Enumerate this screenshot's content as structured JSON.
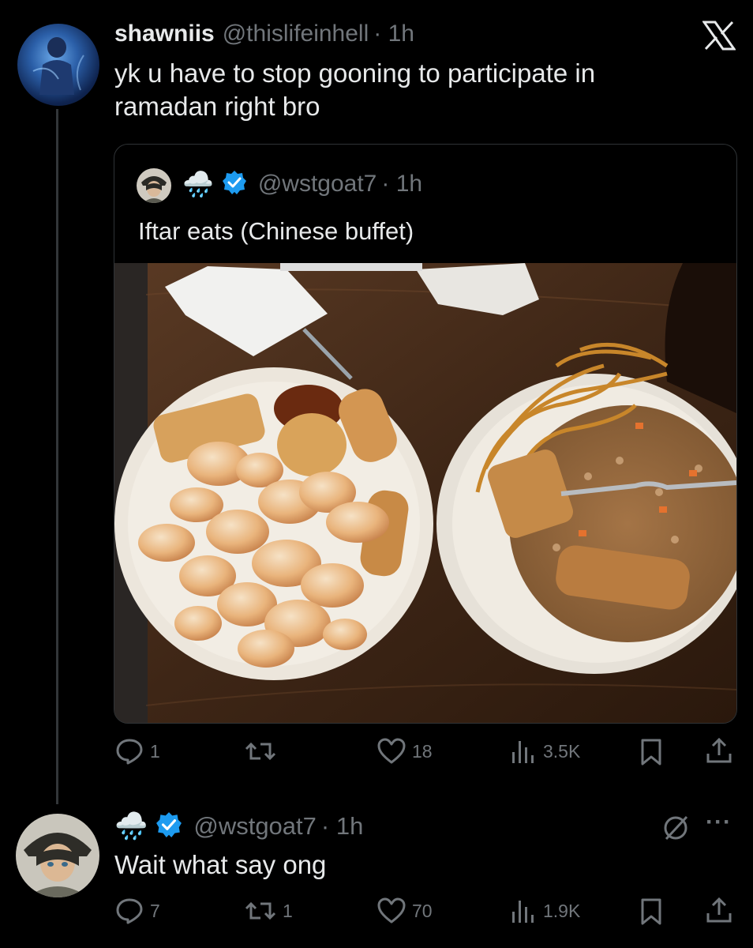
{
  "post": {
    "author_name": "shawniis",
    "author_handle": "@thislifeinhell",
    "time": "· 1h",
    "text_line1": "yk u have to stop gooning to participate in",
    "text_line2": "ramadan right bro"
  },
  "quoted": {
    "name_emoji": "🌧️",
    "author_handle": "@wstgoat7",
    "time": "· 1h",
    "text": "Iftar eats (Chinese buffet)",
    "image_alt": "Two plates of Chinese buffet food: honey shrimp, orange chicken, egg rolls on one; lo mein and fried rice with an egg roll on the other"
  },
  "post_actions": {
    "replies": "1",
    "reposts": "",
    "likes": "18",
    "views": "3.5K"
  },
  "reply": {
    "name_emoji": "🌧️",
    "author_handle": "@wstgoat7",
    "time": "· 1h",
    "text": "Wait what say ong",
    "more": "···"
  },
  "reply_actions": {
    "replies": "7",
    "reposts": "1",
    "likes": "70",
    "views": "1.9K"
  },
  "colors": {
    "background": "#000000",
    "text": "#e7e9ea",
    "muted": "#71767b",
    "verified": "#1d9bf0",
    "border": "#2f3336"
  }
}
